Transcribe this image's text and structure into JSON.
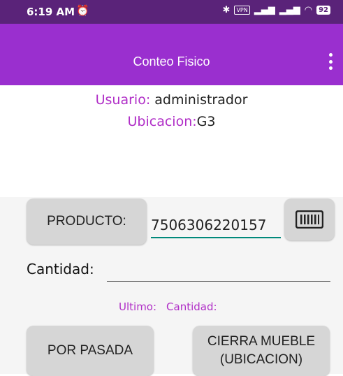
{
  "status_bar": {
    "time": "6:19 AM",
    "vpn": "VPN",
    "battery": "92"
  },
  "app_bar": {
    "title": "Conteo Fisico"
  },
  "info": {
    "usuario_label": "Usuario:",
    "usuario_value": "administrador",
    "ubicacion_label": "Ubicacion:",
    "ubicacion_value": "G3"
  },
  "form": {
    "producto_button": "PRODUCTO:",
    "producto_value": "7506306220157",
    "cantidad_label": "Cantidad:",
    "cantidad_value": "",
    "ultimo_label": "Ultimo:",
    "ultimo_cantidad_label": "Cantidad:"
  },
  "actions": {
    "por_pasada": "POR PASADA",
    "cierra_mueble_line1": "CIERRA MUEBLE",
    "cierra_mueble_line2": "(UBICACION)"
  },
  "colors": {
    "status_bar": "#5a2379",
    "app_bar": "#9a2fcf",
    "accent_text": "#b02ec7",
    "input_underline": "#00897b"
  }
}
